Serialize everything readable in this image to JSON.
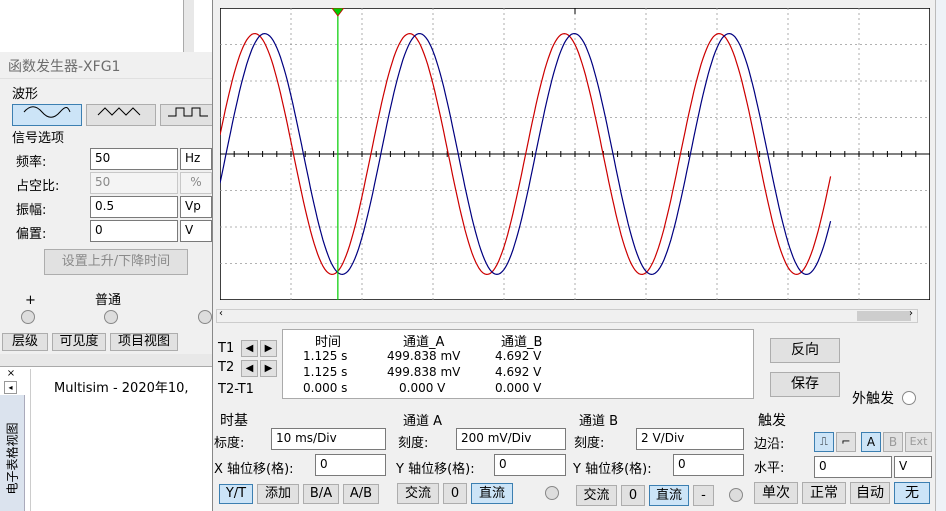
{
  "fg": {
    "title": "函数发生器-XFG1",
    "waveform_heading": "波形",
    "signal_options": "信号选项",
    "freq_label": "频率:",
    "freq_value": "50",
    "freq_unit": "Hz",
    "duty_label": "占空比:",
    "duty_value": "50",
    "duty_unit": "%",
    "amp_label": "振幅:",
    "amp_value": "0.5",
    "amp_unit": "Vp",
    "offset_label": "偏置:",
    "offset_value": "0",
    "offset_unit": "V",
    "rise_fall_button": "设置上升/下降时间",
    "plus": "+",
    "common": "普通"
  },
  "bg": {
    "tabs": [
      "层级",
      "可见度",
      "项目视图"
    ],
    "log_text": "Multisim  -  2020年10,",
    "side_label": "电子表格视图"
  },
  "scope": {
    "readout_headers": [
      "时间",
      "通道_A",
      "通道_B"
    ],
    "rows": [
      {
        "label": "T1",
        "time": "1.125 s",
        "a": "499.838 mV",
        "b": "4.692 V"
      },
      {
        "label": "T2",
        "time": "1.125 s",
        "a": "499.838 mV",
        "b": "4.692 V"
      },
      {
        "label": "T2-T1",
        "time": "0.000 s",
        "a": "0.000 V",
        "b": "0.000 V"
      }
    ],
    "reverse_button": "反向",
    "save_button": "保存",
    "ext_trigger": "外触发",
    "timebase": {
      "title": "时基",
      "scale_label": "标度:",
      "scale_value": "10 ms/Div",
      "xpos_label": "X 轴位移(格):",
      "xpos_value": "0",
      "modes": [
        "Y/T",
        "添加",
        "B/A",
        "A/B"
      ]
    },
    "channel_a": {
      "title": "通道 A",
      "scale_label": "刻度:",
      "scale_value": "200 mV/Div",
      "ypos_label": "Y 轴位移(格):",
      "ypos_value": "0",
      "coupling": [
        "交流",
        "0",
        "直流"
      ]
    },
    "channel_b": {
      "title": "通道 B",
      "scale_label": "刻度:",
      "scale_value": "2  V/Div",
      "ypos_label": "Y 轴位移(格):",
      "ypos_value": "0",
      "coupling": [
        "交流",
        "0",
        "直流",
        "-"
      ]
    },
    "trigger": {
      "title": "触发",
      "edge_label": "边沿:",
      "level_label": "水平:",
      "level_value": "0",
      "level_unit": "V",
      "sources": [
        "A",
        "B",
        "Ext"
      ],
      "modes": [
        "单次",
        "正常",
        "自动",
        "无"
      ]
    }
  },
  "chart_data": {
    "type": "line",
    "xlim": [
      0,
      100
    ],
    "ylim": [
      -4,
      4
    ],
    "grid": true,
    "series": [
      {
        "color": "#cc0000",
        "amplitude": 3.3,
        "period": 21.8,
        "phase": -6.0,
        "x_end": 86
      },
      {
        "color": "#000080",
        "amplitude": 3.3,
        "period": 21.8,
        "phase": -4.6,
        "x_end": 86
      }
    ],
    "cursor_x": 16.6,
    "colors": {
      "ch_a": "#cc0000",
      "ch_b": "#000080",
      "cursor": "#00cc00"
    }
  }
}
